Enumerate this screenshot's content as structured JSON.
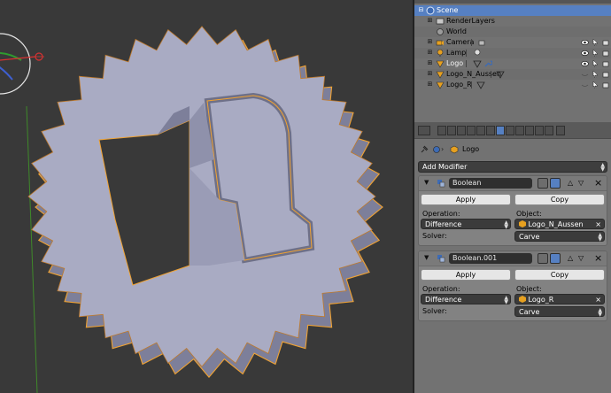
{
  "outliner": {
    "rows": [
      {
        "label": "Scene"
      },
      {
        "label": "RenderLayers"
      },
      {
        "label": "World"
      },
      {
        "label": "Camera"
      },
      {
        "label": "Lamp"
      },
      {
        "label": "Logo"
      },
      {
        "label": "Logo_N_Aussen"
      },
      {
        "label": "Logo_R"
      }
    ]
  },
  "properties": {
    "breadcrumb": "Logo",
    "add_modifier": "Add Modifier",
    "modifiers": [
      {
        "name": "Boolean",
        "apply_label": "Apply",
        "copy_label": "Copy",
        "operation_label": "Operation:",
        "operation_value": "Difference",
        "object_label": "Object:",
        "object_value": "Logo_N_Aussen",
        "solver_label": "Solver:",
        "solver_value": "Carve"
      },
      {
        "name": "Boolean.001",
        "apply_label": "Apply",
        "copy_label": "Copy",
        "operation_label": "Operation:",
        "operation_value": "Difference",
        "object_label": "Object:",
        "object_value": "Logo_R",
        "solver_label": "Solver:",
        "solver_value": "Carve"
      }
    ]
  },
  "colors": {
    "viewport_bg": "#393939",
    "mesh_face": "#a9abc3",
    "mesh_side": "#7d7f9a",
    "selection_outline": "#f0a232",
    "selected_row": "#5680c2"
  }
}
